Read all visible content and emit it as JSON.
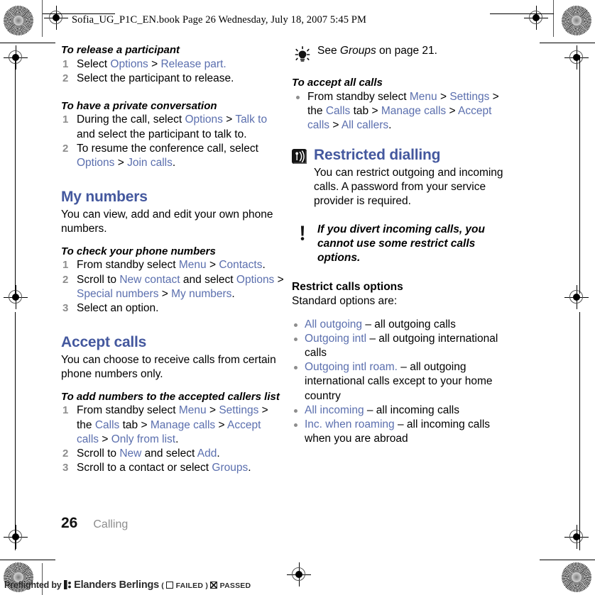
{
  "header": {
    "text": "Sofia_UG_P1C_EN.book  Page 26  Wednesday, July 18, 2007  5:45 PM"
  },
  "left_column": {
    "proc_release": {
      "title": "To release a participant",
      "steps": [
        {
          "parts": [
            {
              "t": "Select ",
              "s": "plain"
            },
            {
              "t": "Options",
              "s": "link"
            },
            {
              "t": " > ",
              "s": "plain"
            },
            {
              "t": "Release part.",
              "s": "link"
            }
          ]
        },
        {
          "parts": [
            {
              "t": "Select the participant to release.",
              "s": "plain"
            }
          ]
        }
      ]
    },
    "proc_private": {
      "title": "To have a private conversation",
      "steps": [
        {
          "parts": [
            {
              "t": "During the call, select ",
              "s": "plain"
            },
            {
              "t": "Options",
              "s": "link"
            },
            {
              "t": " > ",
              "s": "plain"
            },
            {
              "t": "Talk to",
              "s": "link"
            },
            {
              "t": " and select the participant to talk to.",
              "s": "plain"
            }
          ]
        },
        {
          "parts": [
            {
              "t": "To resume the conference call, select ",
              "s": "plain"
            },
            {
              "t": "Options",
              "s": "link"
            },
            {
              "t": " > ",
              "s": "plain"
            },
            {
              "t": "Join calls",
              "s": "link"
            },
            {
              "t": ".",
              "s": "plain"
            }
          ]
        }
      ]
    },
    "section_my_numbers": {
      "heading": "My numbers",
      "intro": "You can view, add and edit your own phone numbers.",
      "proc_check": {
        "title": "To check your phone numbers",
        "steps": [
          {
            "parts": [
              {
                "t": "From standby select ",
                "s": "plain"
              },
              {
                "t": "Menu",
                "s": "link"
              },
              {
                "t": " > ",
                "s": "plain"
              },
              {
                "t": "Contacts",
                "s": "link"
              },
              {
                "t": ".",
                "s": "plain"
              }
            ]
          },
          {
            "parts": [
              {
                "t": "Scroll to ",
                "s": "plain"
              },
              {
                "t": "New contact",
                "s": "link"
              },
              {
                "t": " and select ",
                "s": "plain"
              },
              {
                "t": "Options",
                "s": "link"
              },
              {
                "t": " > ",
                "s": "plain"
              },
              {
                "t": "Special numbers",
                "s": "link"
              },
              {
                "t": " > ",
                "s": "plain"
              },
              {
                "t": "My numbers",
                "s": "link"
              },
              {
                "t": ".",
                "s": "plain"
              }
            ]
          },
          {
            "parts": [
              {
                "t": "Select an option.",
                "s": "plain"
              }
            ]
          }
        ]
      }
    },
    "section_accept_calls": {
      "heading": "Accept calls",
      "intro": "You can choose to receive calls from certain phone numbers only.",
      "proc_add": {
        "title": "To add numbers to the accepted callers list",
        "steps": [
          {
            "parts": [
              {
                "t": "From standby select ",
                "s": "plain"
              },
              {
                "t": "Menu",
                "s": "link"
              },
              {
                "t": " > ",
                "s": "plain"
              },
              {
                "t": "Settings",
                "s": "link"
              },
              {
                "t": " > the ",
                "s": "plain"
              },
              {
                "t": "Calls",
                "s": "link"
              },
              {
                "t": " tab > ",
                "s": "plain"
              },
              {
                "t": "Manage calls",
                "s": "link"
              },
              {
                "t": " > ",
                "s": "plain"
              },
              {
                "t": "Accept calls",
                "s": "link"
              },
              {
                "t": " > ",
                "s": "plain"
              },
              {
                "t": "Only from list",
                "s": "link"
              },
              {
                "t": ".",
                "s": "plain"
              }
            ]
          },
          {
            "parts": [
              {
                "t": "Scroll to ",
                "s": "plain"
              },
              {
                "t": "New",
                "s": "link"
              },
              {
                "t": " and select ",
                "s": "plain"
              },
              {
                "t": "Add",
                "s": "link"
              },
              {
                "t": ".",
                "s": "plain"
              }
            ]
          },
          {
            "parts": [
              {
                "t": "Scroll to a contact or select ",
                "s": "plain"
              },
              {
                "t": "Groups",
                "s": "link"
              },
              {
                "t": ".",
                "s": "plain"
              }
            ]
          }
        ]
      }
    }
  },
  "right_column": {
    "tip_note": {
      "icon": "lightbulb-icon",
      "parts": [
        {
          "t": "See ",
          "s": "plain"
        },
        {
          "t": "Groups",
          "s": "italic"
        },
        {
          "t": " on page 21.",
          "s": "plain"
        }
      ]
    },
    "proc_accept_all": {
      "title": "To accept all calls",
      "bullets": [
        {
          "parts": [
            {
              "t": "From standby select ",
              "s": "plain"
            },
            {
              "t": "Menu",
              "s": "link"
            },
            {
              "t": " > ",
              "s": "plain"
            },
            {
              "t": "Settings",
              "s": "link"
            },
            {
              "t": " > the ",
              "s": "plain"
            },
            {
              "t": "Calls",
              "s": "link"
            },
            {
              "t": " tab > ",
              "s": "plain"
            },
            {
              "t": "Manage calls",
              "s": "link"
            },
            {
              "t": " > ",
              "s": "plain"
            },
            {
              "t": "Accept calls",
              "s": "link"
            },
            {
              "t": " > ",
              "s": "plain"
            },
            {
              "t": "All callers",
              "s": "link"
            },
            {
              "t": ".",
              "s": "plain"
            }
          ]
        }
      ]
    },
    "section_restricted": {
      "icon": "signal-antenna-icon",
      "heading": "Restricted dialling",
      "intro": "You can restrict outgoing and incoming calls. A password from your service provider is required."
    },
    "warn_note": {
      "icon": "exclamation-icon",
      "text": "If you divert incoming calls, you cannot use some restrict calls options."
    },
    "restrict_options": {
      "title": "Restrict calls options",
      "subtitle": "Standard options are:",
      "items": [
        {
          "parts": [
            {
              "t": "All outgoing",
              "s": "link"
            },
            {
              "t": " – all outgoing calls",
              "s": "plain"
            }
          ]
        },
        {
          "parts": [
            {
              "t": "Outgoing intl",
              "s": "link"
            },
            {
              "t": " – all outgoing international calls",
              "s": "plain"
            }
          ]
        },
        {
          "parts": [
            {
              "t": "Outgoing intl roam.",
              "s": "link"
            },
            {
              "t": " – all outgoing international calls except to your home country",
              "s": "plain"
            }
          ]
        },
        {
          "parts": [
            {
              "t": "All incoming",
              "s": "link"
            },
            {
              "t": " – all incoming calls",
              "s": "plain"
            }
          ]
        },
        {
          "parts": [
            {
              "t": "Inc. when roaming",
              "s": "link"
            },
            {
              "t": " – all incoming calls when you are abroad",
              "s": "plain"
            }
          ]
        }
      ]
    }
  },
  "footer": {
    "page_number": "26",
    "running_head": "Calling"
  },
  "preflight": {
    "prefix": "Preflighted by",
    "company": "Elanders Berlings",
    "open_paren": "(",
    "failed_label": "FAILED",
    "close_paren": ")",
    "passed_label": "PASSED",
    "failed_checked": false,
    "passed_checked": true
  },
  "colors": {
    "heading_blue": "#44589e",
    "link_blue": "#5b6fae",
    "step_number_gray": "#8d8d8d",
    "running_head_gray": "#8d8d8d"
  }
}
